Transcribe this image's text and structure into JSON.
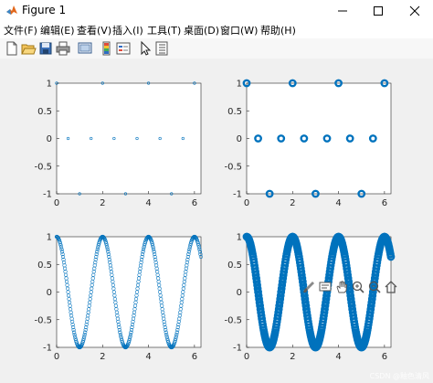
{
  "window": {
    "title": "Figure 1",
    "icons": {
      "app": "matlab-logo-icon",
      "minimize": "minimize-icon",
      "maximize": "maximize-icon",
      "close": "close-icon"
    }
  },
  "menubar": {
    "items": [
      "文件(F)",
      "编辑(E)",
      "查看(V)",
      "插入(I)",
      "工具(T)",
      "桌面(D)",
      "窗口(W)",
      "帮助(H)"
    ]
  },
  "toolbar": {
    "buttons": [
      "new-figure-icon",
      "open-file-icon",
      "save-icon",
      "print-icon",
      "link-plot-icon",
      "colorbar-icon",
      "legend-icon",
      "edit-plot-arrow-icon",
      "property-inspector-icon"
    ]
  },
  "axes_toolbar": {
    "buttons": [
      "brush-icon",
      "data-tips-icon",
      "pan-hand-icon",
      "zoom-in-icon",
      "zoom-out-icon",
      "restore-view-home-icon"
    ]
  },
  "colors": {
    "series": "#0072bd",
    "axes_bg": "#ffffff",
    "figure_bg": "#f0f0f0"
  },
  "watermark": "CSDN @釉色清风",
  "chart_data": [
    {
      "type": "scatter",
      "function": "cos(pi*x)",
      "x_step": 0.5,
      "x": [
        0,
        0.5,
        1,
        1.5,
        2,
        2.5,
        3,
        3.5,
        4,
        4.5,
        5,
        5.5,
        6
      ],
      "marker": "circle",
      "marker_size": "tiny",
      "xlim": [
        0,
        6.283
      ],
      "ylim": [
        -1,
        1
      ],
      "xticks": [
        "0",
        "2",
        "4",
        "6"
      ],
      "yticks": [
        "1",
        "0.5",
        "0",
        "-0.5",
        "-1"
      ]
    },
    {
      "type": "scatter",
      "function": "cos(pi*x)",
      "x_step": 0.5,
      "x": [
        0,
        0.5,
        1,
        1.5,
        2,
        2.5,
        3,
        3.5,
        4,
        4.5,
        5,
        5.5,
        6
      ],
      "marker": "circle",
      "marker_size": "large",
      "line_width": "thick",
      "xlim": [
        0,
        6.283
      ],
      "ylim": [
        -1,
        1
      ],
      "xticks": [
        "0",
        "2",
        "4",
        "6"
      ],
      "yticks": [
        "1",
        "0.5",
        "0",
        "-0.5",
        "-1"
      ]
    },
    {
      "type": "scatter",
      "function": "cos(pi*x)",
      "x_step": 0.02,
      "marker": "circle",
      "marker_size": "small",
      "xlim": [
        0,
        6.283
      ],
      "ylim": [
        -1,
        1
      ],
      "xticks": [
        "0",
        "2",
        "4",
        "6"
      ],
      "yticks": [
        "1",
        "0.5",
        "0",
        "-0.5",
        "-1"
      ]
    },
    {
      "type": "scatter",
      "function": "cos(pi*x)",
      "x_step": 0.02,
      "marker": "circle",
      "marker_size": "large",
      "line_width": "thick",
      "xlim": [
        0,
        6.283
      ],
      "ylim": [
        -1,
        1
      ],
      "xticks": [
        "0",
        "2",
        "4",
        "6"
      ],
      "yticks": [
        "1",
        "0.5",
        "0",
        "-0.5",
        "-1"
      ]
    }
  ]
}
